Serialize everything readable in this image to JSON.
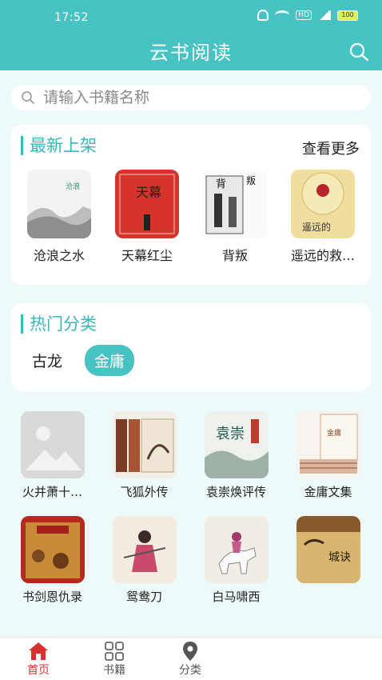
{
  "status": {
    "time": "17:52",
    "battery": "100"
  },
  "header": {
    "title": "云书阅读"
  },
  "search": {
    "placeholder": "请输入书籍名称"
  },
  "new_arrivals": {
    "title": "最新上架",
    "more": "查看更多",
    "books": [
      {
        "title": "沧浪之水"
      },
      {
        "title": "天幕红尘"
      },
      {
        "title": "背叛"
      },
      {
        "title": "遥远的救…"
      }
    ]
  },
  "hot_categories": {
    "title": "热门分类",
    "items": [
      {
        "label": "古龙"
      },
      {
        "label": "金庸",
        "selected": true
      }
    ]
  },
  "grid_books": [
    {
      "title": "火并萧十…"
    },
    {
      "title": "飞狐外传"
    },
    {
      "title": "袁崇焕评传"
    },
    {
      "title": "金庸文集"
    },
    {
      "title": "书剑恩仇录"
    },
    {
      "title": "鸳鸯刀"
    },
    {
      "title": "白马啸西"
    },
    {
      "title": ""
    }
  ],
  "tabbar": {
    "items": [
      {
        "label": "首页",
        "icon": "home-icon",
        "active": true
      },
      {
        "label": "书籍",
        "icon": "grid-icon"
      },
      {
        "label": "分类",
        "icon": "location-pin-icon"
      }
    ]
  },
  "colors": {
    "accent": "#47c3c3",
    "active_tab": "#d93030",
    "background": "#eef9f9"
  }
}
